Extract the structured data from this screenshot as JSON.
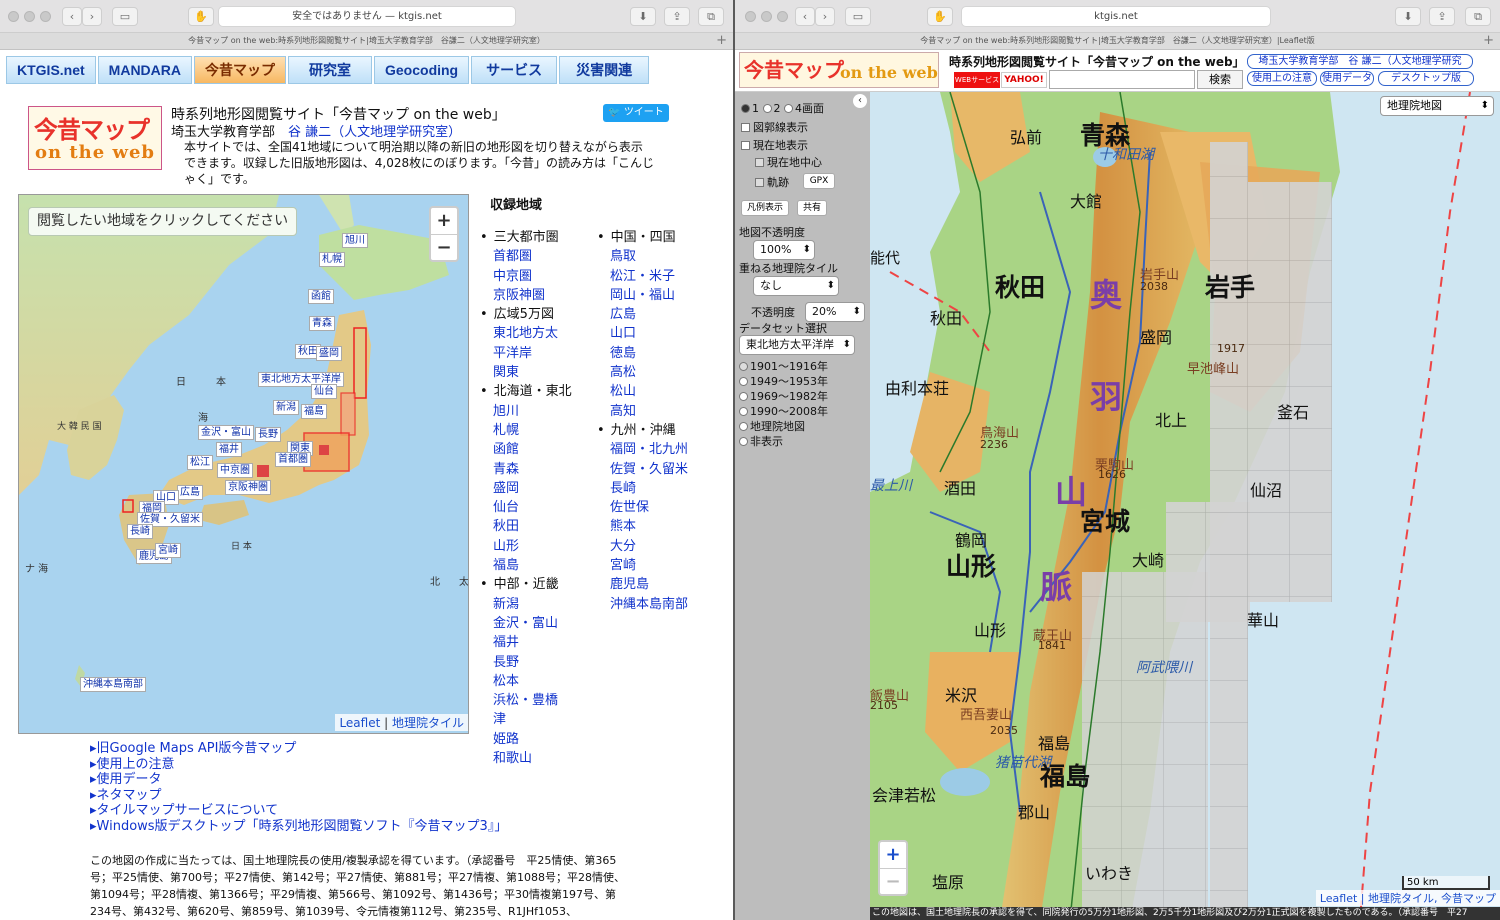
{
  "left": {
    "address": "安全ではありません — ktgis.net",
    "tab_title": "今昔マップ on the web:時系列地形図閲覧サイト|埼玉大学教育学部　谷謙二（人文地理学研究室）",
    "nav": [
      "KTGIS.net",
      "MANDARA",
      "今昔マップ",
      "研究室",
      "Geocoding",
      "サービス",
      "災害関連"
    ],
    "site_title": "時系列地形図閲覧サイト「今昔マップ on the web」",
    "affiliation": "埼玉大学教育学部",
    "author": "谷 謙二（人文地理学研究室）",
    "tweet": "ツイート",
    "intro": "本サイトでは、全国41地域について明治期以降の新旧の地形図を切り替えながら表示できます。収録した旧版地形図は、4,028枚にのぼります。「今昔」の読み方は「こんじゃく」です。",
    "map_hint": "閲覧したい地域をクリックしてください",
    "attribution_leaflet": "Leaflet",
    "attribution_tile": "地理院タイル",
    "regions_heading": "収録地域",
    "col1": [
      {
        "t": "cat",
        "v": "三大都市圏"
      },
      {
        "t": "it",
        "v": "首都圏"
      },
      {
        "t": "it",
        "v": "中京圏"
      },
      {
        "t": "it",
        "v": "京阪神圏"
      },
      {
        "t": "cat",
        "v": "広域5万図"
      },
      {
        "t": "it",
        "v": "東北地方太"
      },
      {
        "t": "it",
        "v": "平洋岸"
      },
      {
        "t": "it",
        "v": "関東"
      },
      {
        "t": "cat",
        "v": "北海道・東北"
      },
      {
        "t": "it",
        "v": "旭川"
      },
      {
        "t": "it",
        "v": "札幌"
      },
      {
        "t": "it",
        "v": "函館"
      },
      {
        "t": "it",
        "v": "青森"
      },
      {
        "t": "it",
        "v": "盛岡"
      },
      {
        "t": "it",
        "v": "仙台"
      },
      {
        "t": "it",
        "v": "秋田"
      },
      {
        "t": "it",
        "v": "山形"
      },
      {
        "t": "it",
        "v": "福島"
      },
      {
        "t": "cat",
        "v": "中部・近畿"
      },
      {
        "t": "it",
        "v": "新潟"
      },
      {
        "t": "it",
        "v": "金沢・富山"
      },
      {
        "t": "it",
        "v": "福井"
      },
      {
        "t": "it",
        "v": "長野"
      },
      {
        "t": "it",
        "v": "松本"
      },
      {
        "t": "it",
        "v": "浜松・豊橋"
      },
      {
        "t": "it",
        "v": "津"
      },
      {
        "t": "it",
        "v": "姫路"
      },
      {
        "t": "it",
        "v": "和歌山"
      }
    ],
    "col2": [
      {
        "t": "cat",
        "v": "中国・四国"
      },
      {
        "t": "it",
        "v": "鳥取"
      },
      {
        "t": "it",
        "v": "松江・米子"
      },
      {
        "t": "it",
        "v": "岡山・福山"
      },
      {
        "t": "it",
        "v": "広島"
      },
      {
        "t": "it",
        "v": "山口"
      },
      {
        "t": "it",
        "v": "徳島"
      },
      {
        "t": "it",
        "v": "高松"
      },
      {
        "t": "it",
        "v": "松山"
      },
      {
        "t": "it",
        "v": "高知"
      },
      {
        "t": "cat",
        "v": "九州・沖縄"
      },
      {
        "t": "it",
        "v": "福岡・北九州"
      },
      {
        "t": "it",
        "v": "佐賀・久留米"
      },
      {
        "t": "it",
        "v": "長崎"
      },
      {
        "t": "it",
        "v": "佐世保"
      },
      {
        "t": "it",
        "v": "熊本"
      },
      {
        "t": "it",
        "v": "大分"
      },
      {
        "t": "it",
        "v": "宮崎"
      },
      {
        "t": "it",
        "v": "鹿児島"
      },
      {
        "t": "it",
        "v": "沖縄本島南部"
      }
    ],
    "links": [
      "旧Google Maps API版今昔マップ",
      "使用上の注意",
      "使用データ",
      "ネタマップ",
      "タイルマップサービスについて",
      "Windows版デスクトップ「時系列地形図閲覧ソフト『今昔マップ3』」"
    ],
    "copyright": "この地図の作成に当たっては、国土地理院長の使用/複製承認を得ています。（承認番号　平25情使、第365号；平25情使、第700号；平27情使、第142号；平27情使、第881号；平27情複、第1088号；平28情使、第1094号；平28情複、第1366号；平29情複、第566号、第1092号、第1436号；平30情複第197号、第234号、第432号、第620号、第859号、第1039号、令元情複第112号、第235号、R1JHf1053、",
    "map_labels": [
      "旭川",
      "札幌",
      "函館",
      "青森",
      "秋田",
      "盛岡",
      "東北地方太平洋岸",
      "仙台",
      "新潟",
      "福島",
      "金沢・富山",
      "長野",
      "福井",
      "関東",
      "松江",
      "首都圏",
      "中京圏",
      "広島",
      "京阪神圏",
      "山口",
      "福岡",
      "佐賀・久留米",
      "長崎",
      "鹿児島",
      "宮崎",
      "沖縄本島南部"
    ],
    "sea_labels": [
      "日",
      "本",
      "海",
      "大 韓 民 国",
      "ナ 海",
      "北",
      "太",
      "日 本"
    ]
  },
  "right": {
    "address": "ktgis.net",
    "tab_title": "今昔マップ on the web:時系列地形図閲覧サイト|埼玉大学教育学部　谷謙二（人文地理学研究室）|Leaflet版",
    "logo_a": "今昔マップ",
    "logo_b": "on the web",
    "title": "時系列地形図閲覧サイト「今昔マップ on the web」",
    "badge_web": "WEBサービス",
    "badge_yahoo": "YAHOO!",
    "search_btn": "検索",
    "link_univ": "埼玉大学教育学部　谷 謙二（人文地理学研究",
    "link_notes": "使用上の注意",
    "link_data": "使用データ",
    "link_desktop": "デスクトップ版",
    "screens": [
      "1",
      "2",
      "4画面"
    ],
    "show_grid": "図郭線表示",
    "show_location": "現在地表示",
    "center_location": "現在地中心",
    "track": "軌跡",
    "gpx": "GPX",
    "legend_btn": "凡例表示",
    "share_btn": "共有",
    "opacity_label": "地図不透明度",
    "opacity_value": "100%",
    "overlay_label": "重ねる地理院タイル",
    "overlay_value": "なし",
    "overlay_opacity_label": "不透明度",
    "overlay_opacity_value": "20%",
    "dataset_label": "データセット選択",
    "dataset_value": "東北地方太平洋岸",
    "periods": [
      "1901〜1916年",
      "1949〜1953年",
      "1969〜1982年",
      "1990〜2008年",
      "地理院地図",
      "非表示"
    ],
    "base_layer": "地理院地図",
    "scale": "50 km",
    "attribution": "Leaflet | 地理院タイル, 今昔マップ",
    "footer": "この地図は、国土地理院長の承認を得て、同院発行の5万分1地形図、2万5千分1地形図及び2万分1正式図を複製したものである。（承認番号　平27",
    "places": [
      {
        "n": "弘前",
        "s": "l"
      },
      {
        "n": "青森",
        "s": "xl"
      },
      {
        "n": "十和田湖",
        "s": "w"
      },
      {
        "n": "大館",
        "s": "l"
      },
      {
        "n": "能代",
        "s": "m"
      },
      {
        "n": "秋田",
        "s": "xl"
      },
      {
        "n": "奥",
        "s": "mt"
      },
      {
        "n": "岩手",
        "s": "xl"
      },
      {
        "n": "岩手山",
        "s": "p"
      },
      {
        "n": "2038",
        "s": "e"
      },
      {
        "n": "盛岡",
        "s": "l"
      },
      {
        "n": "秋田",
        "s": "l"
      },
      {
        "n": "1917",
        "s": "e"
      },
      {
        "n": "早池峰山",
        "s": "p"
      },
      {
        "n": "羽",
        "s": "mt"
      },
      {
        "n": "由利本荘",
        "s": "l"
      },
      {
        "n": "北上",
        "s": "l"
      },
      {
        "n": "釜石",
        "s": "l"
      },
      {
        "n": "鳥海山",
        "s": "p"
      },
      {
        "n": "2236",
        "s": "e"
      },
      {
        "n": "栗駒山",
        "s": "p"
      },
      {
        "n": "1626",
        "s": "e"
      },
      {
        "n": "最上川",
        "s": "w"
      },
      {
        "n": "酒田",
        "s": "l"
      },
      {
        "n": "山",
        "s": "mt"
      },
      {
        "n": "宮城",
        "s": "xl"
      },
      {
        "n": "仙沼",
        "s": "l"
      },
      {
        "n": "鶴岡",
        "s": "l"
      },
      {
        "n": "山形",
        "s": "xl"
      },
      {
        "n": "大崎",
        "s": "l"
      },
      {
        "n": "脈",
        "s": "mt"
      },
      {
        "n": "山形",
        "s": "l"
      },
      {
        "n": "蔵王山",
        "s": "p"
      },
      {
        "n": "1841",
        "s": "e"
      },
      {
        "n": "華山",
        "s": "l"
      },
      {
        "n": "阿武隈川",
        "s": "w"
      },
      {
        "n": "飯豊山",
        "s": "p"
      },
      {
        "n": "2105",
        "s": "e"
      },
      {
        "n": "米沢",
        "s": "l"
      },
      {
        "n": "西吾妻山",
        "s": "p"
      },
      {
        "n": "2035",
        "s": "e"
      },
      {
        "n": "福島",
        "s": "l"
      },
      {
        "n": "猪苗代湖",
        "s": "w"
      },
      {
        "n": "福島",
        "s": "xl"
      },
      {
        "n": "会津若松",
        "s": "l"
      },
      {
        "n": "郡山",
        "s": "l"
      },
      {
        "n": "いわき",
        "s": "l"
      },
      {
        "n": "塩原",
        "s": "l"
      }
    ]
  }
}
